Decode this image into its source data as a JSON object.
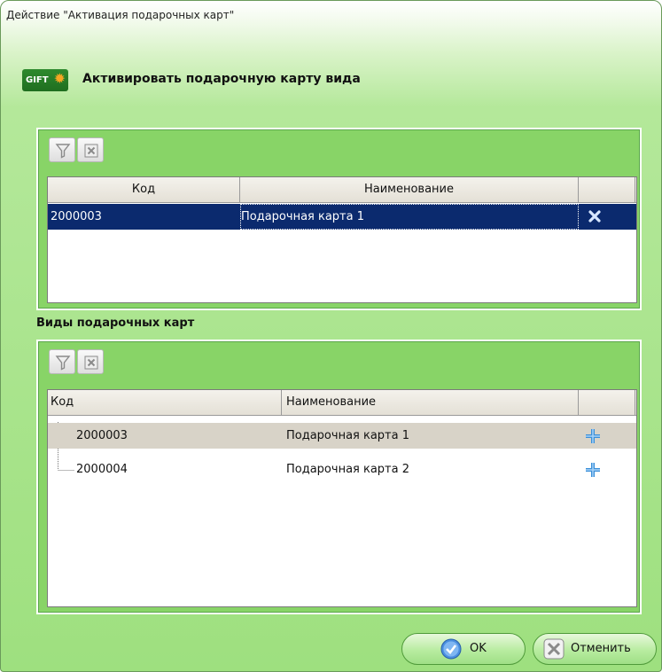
{
  "window": {
    "title": "Действие \"Активация подарочных карт\""
  },
  "header": {
    "logo_text": "GIFT",
    "label": "Активировать подарочную карту вида"
  },
  "top_grid": {
    "columns": [
      "Код",
      "Наименование"
    ],
    "rows": [
      {
        "code": "2000003",
        "name": "Подарочная карта 1",
        "selected": true
      }
    ]
  },
  "section": {
    "label": "Виды подарочных карт"
  },
  "bottom_grid": {
    "columns": [
      "Код",
      "Наименование"
    ],
    "rows": [
      {
        "code": "2000003",
        "name": "Подарочная карта 1"
      },
      {
        "code": "2000004",
        "name": "Подарочная карта 2"
      }
    ]
  },
  "buttons": {
    "ok": "OK",
    "cancel": "Отменить"
  },
  "colors": {
    "selection": "#0b2a6e",
    "accent_plus": "#3a8fd8",
    "panel": "#88d467"
  }
}
